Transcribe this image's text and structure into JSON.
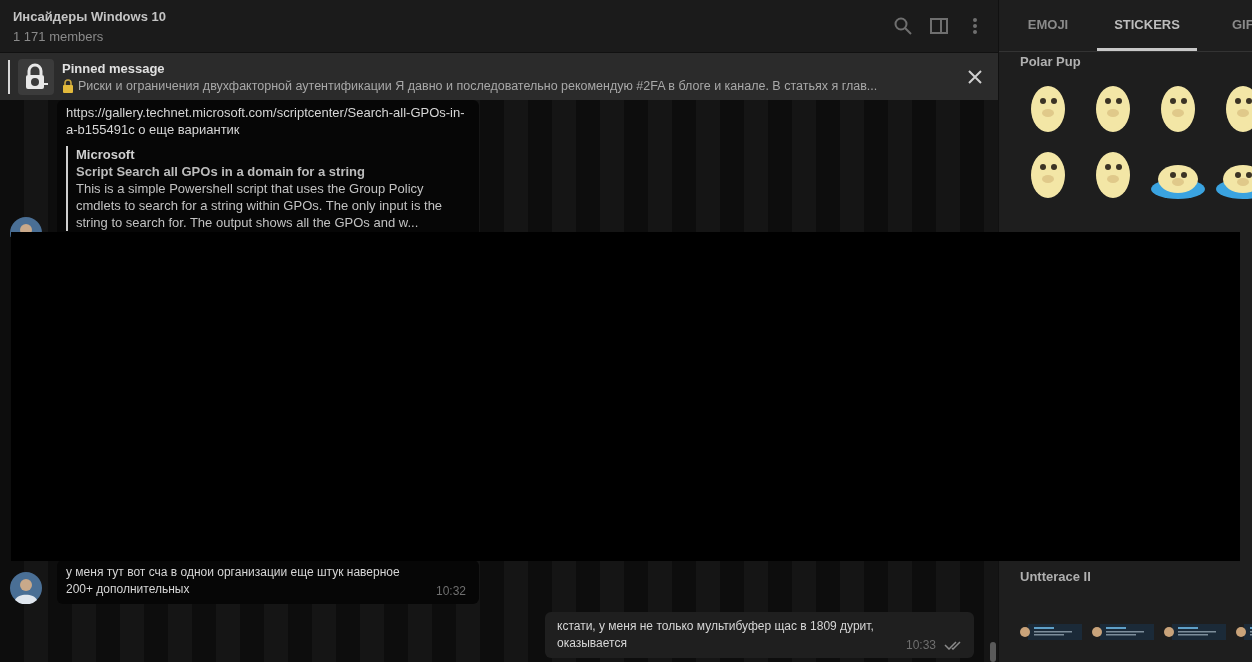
{
  "chat": {
    "title": "Инсайдеры Windows 10",
    "members": "1 171 members"
  },
  "pinned": {
    "label": "Pinned message",
    "text": "Риски и ограничения двухфакторной аутентификации  Я давно и последовательно рекомендую #2FA в блоге и канале. В статьях я глав..."
  },
  "messages": [
    {
      "kind": "incoming",
      "text": "https://gallery.technet.microsoft.com/scriptcenter/Search-all-GPOs-in-a-b155491c о еще вариантик",
      "preview": {
        "site": "Microsoft",
        "title": "Script Search all GPOs in a domain for a string",
        "description": "This is a simple Powershell script that uses the Group Policy cmdlets to search for a string within GPOs.  The only input is the string to search for.  The output shows all the GPOs and w..."
      }
    },
    {
      "kind": "incoming",
      "text": "у меня тут вот сча в однои организации еще штук наверное 200+ дополнительных",
      "time": "10:32"
    },
    {
      "kind": "outgoing",
      "text": "кстати, у меня не только мультибуфер щас в 1809 дурит, оказывается",
      "time": "10:33",
      "read": true
    }
  ],
  "tabs": [
    {
      "label": "EMOJI",
      "selected": false
    },
    {
      "label": "STICKERS",
      "selected": true
    },
    {
      "label": "GIF",
      "selected": false
    }
  ],
  "sticker_sets": [
    {
      "title": "Polar Pup",
      "stickers": [
        {
          "kind": "seal"
        },
        {
          "kind": "seal"
        },
        {
          "kind": "seal"
        },
        {
          "kind": "seal"
        },
        {
          "kind": "seal"
        },
        {
          "kind": "seal"
        },
        {
          "kind": "seal-puddle"
        },
        {
          "kind": "seal-puddle"
        }
      ]
    },
    {
      "title": "Untterace II"
    }
  ],
  "redaction": true
}
